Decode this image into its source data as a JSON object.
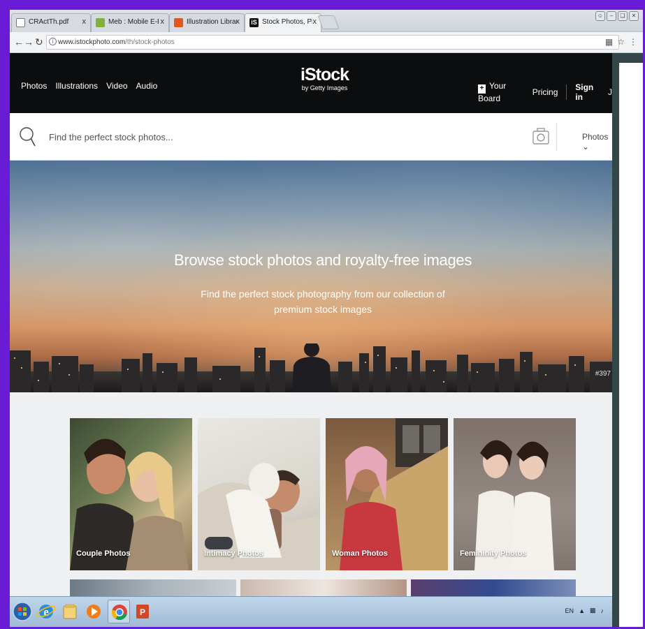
{
  "browser": {
    "tabs": [
      {
        "title": "CRActTh.pdf",
        "icon": "document-icon",
        "active": false
      },
      {
        "title": "Meb : Mobile E-Books |",
        "icon": "ebook-icon",
        "active": false
      },
      {
        "title": "Illustration Library on O",
        "icon": "library-icon",
        "active": false
      },
      {
        "title": "Stock Photos, Pictures an",
        "icon": "istock-icon",
        "active": true
      }
    ],
    "close_glyph": "x",
    "url_domain": "www.istockphoto.com",
    "url_path": "/th/stock-photos"
  },
  "site": {
    "nav": [
      "Photos",
      "Illustrations",
      "Video",
      "Audio"
    ],
    "logo_main": "iStock",
    "logo_sub": "by Getty Images",
    "board_label": "Your Board",
    "pricing_label": "Pricing",
    "signin_label": "Sign in",
    "join_label": "J"
  },
  "search": {
    "placeholder": "Find the perfect stock photos...",
    "type_label": "Photos"
  },
  "hero": {
    "title": "Browse stock photos and royalty-free images",
    "subtitle": "Find the perfect stock photography from our collection of premium stock images",
    "tag": "#397"
  },
  "categories": [
    {
      "label": "Couple Photos"
    },
    {
      "label": "Intimacy Photos"
    },
    {
      "label": "Woman Photos"
    },
    {
      "label": "Femininity Photos"
    }
  ],
  "taskbar": {
    "lang": "EN"
  },
  "colors": {
    "frame": "#6a1bd6",
    "header_bg": "#0c0d0e",
    "gallery_bg": "#eef0f1",
    "right_strip": "#33474a"
  }
}
